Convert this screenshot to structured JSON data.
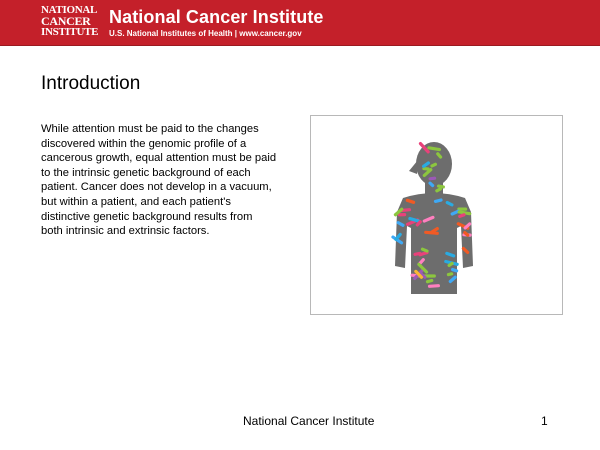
{
  "header": {
    "logo": [
      "NATIONAL",
      "CANCER",
      "INSTITUTE"
    ],
    "org_name": "National Cancer Institute",
    "subtitle": "U.S. National Institutes of Health  |  www.cancer.gov",
    "bg_color": "#c4202a"
  },
  "slide": {
    "title": "Introduction",
    "body": "While attention must be paid to the changes discovered within the genomic profile of a cancerous growth, equal attention must be paid to the intrinsic genetic background of each patient.  Cancer does not develop in a vacuum, but  within a patient, and each patient's distinctive genetic background results from both intrinsic and extrinsic factors."
  },
  "figure": {
    "icon": "human-silhouette-chromosomes-icon",
    "silhouette_color": "#6d6d6d",
    "chromosome_colors": [
      "#e8427a",
      "#3fa9f5",
      "#f7b733",
      "#8cc63f",
      "#9b59b6",
      "#f15a24",
      "#29abe2",
      "#ff7fbf"
    ]
  },
  "footer": {
    "center": "National Cancer Institute",
    "page_number": "1"
  }
}
